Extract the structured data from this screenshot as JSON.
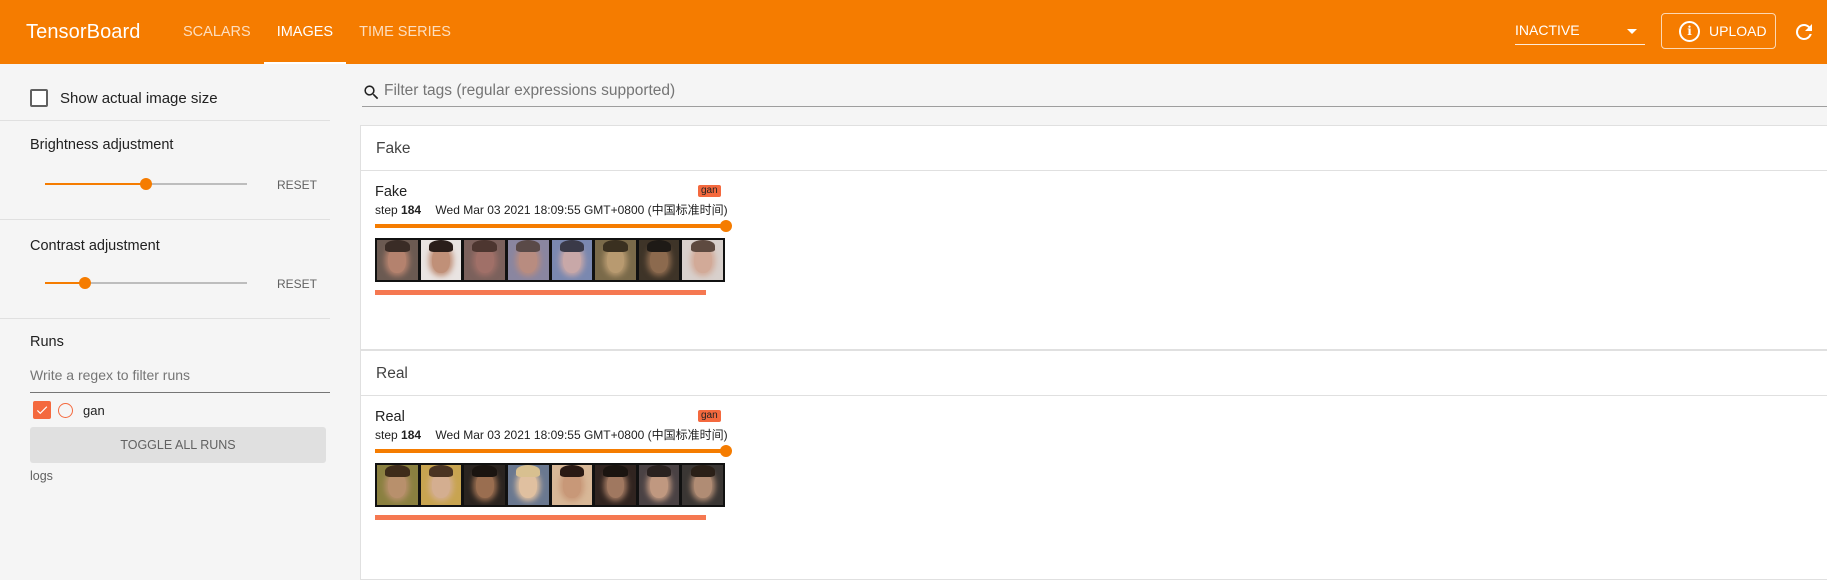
{
  "app": {
    "title": "TensorBoard",
    "tabs": [
      {
        "label": "SCALARS",
        "active": false
      },
      {
        "label": "IMAGES",
        "active": true
      },
      {
        "label": "TIME SERIES",
        "active": false
      }
    ],
    "status_select": "INACTIVE",
    "upload_label": "UPLOAD",
    "accent_color": "#f57c00",
    "run_color": "#f4693e"
  },
  "sidebar": {
    "show_actual_size_label": "Show actual image size",
    "show_actual_size_checked": false,
    "brightness": {
      "label": "Brightness adjustment",
      "reset_label": "RESET",
      "value_fraction": 0.5
    },
    "contrast": {
      "label": "Contrast adjustment",
      "reset_label": "RESET",
      "value_fraction": 0.2
    },
    "runs": {
      "title": "Runs",
      "filter_placeholder": "Write a regex to filter runs",
      "items": [
        {
          "name": "gan",
          "checked": true
        }
      ],
      "toggle_all_label": "TOGGLE ALL RUNS",
      "logdir": "logs"
    }
  },
  "main": {
    "filter_placeholder": "Filter tags (regular expressions supported)",
    "groups": [
      {
        "name": "Fake",
        "card": {
          "tag": "Fake",
          "run": "gan",
          "step_label": "step",
          "step": "184",
          "timestamp": "Wed Mar 03 2021 18:09:55 GMT+0800 (中国标准时间)",
          "image_count": 8
        }
      },
      {
        "name": "Real",
        "card": {
          "tag": "Real",
          "run": "gan",
          "step_label": "step",
          "step": "184",
          "timestamp": "Wed Mar 03 2021 18:09:55 GMT+0800 (中国标准时间)",
          "image_count": 8
        }
      }
    ]
  },
  "icons": {
    "info": "info-icon",
    "refresh": "refresh-icon",
    "search": "search-icon",
    "check": "check-icon",
    "dropdown": "chevron-down-icon"
  }
}
